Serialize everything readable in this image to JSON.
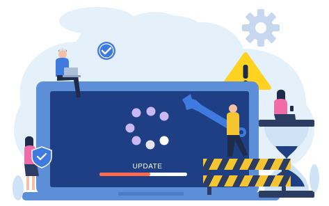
{
  "illustration": {
    "screen_text": "UPDATE",
    "progress": 0.58,
    "colors": {
      "background_blob": "#e4f1fb",
      "laptop_frame": "#5d8fd9",
      "laptop_screen": "#1f3f84",
      "accent_blue": "#3f7ae0",
      "gear": "#c5d8ee",
      "warning_yellow": "#ffd21f",
      "progress_track": "#ffffff",
      "progress_fill": "#ff6a4d",
      "barrier_yellow": "#f5c431",
      "barrier_dark": "#2c3d64",
      "check_circle": "#3f7ae0"
    },
    "icons": [
      "check-circle-icon",
      "gear-icon",
      "warning-triangle-icon",
      "wrench-icon",
      "shield-check-icon",
      "loading-spinner-icon",
      "hourglass-icon"
    ]
  }
}
